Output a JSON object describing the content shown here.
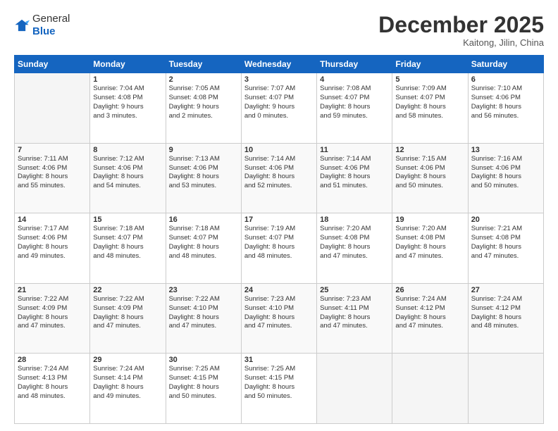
{
  "header": {
    "logo_line1": "General",
    "logo_line2": "Blue",
    "month": "December 2025",
    "location": "Kaitong, Jilin, China"
  },
  "weekdays": [
    "Sunday",
    "Monday",
    "Tuesday",
    "Wednesday",
    "Thursday",
    "Friday",
    "Saturday"
  ],
  "weeks": [
    [
      {
        "day": "",
        "info": ""
      },
      {
        "day": "1",
        "info": "Sunrise: 7:04 AM\nSunset: 4:08 PM\nDaylight: 9 hours\nand 3 minutes."
      },
      {
        "day": "2",
        "info": "Sunrise: 7:05 AM\nSunset: 4:08 PM\nDaylight: 9 hours\nand 2 minutes."
      },
      {
        "day": "3",
        "info": "Sunrise: 7:07 AM\nSunset: 4:07 PM\nDaylight: 9 hours\nand 0 minutes."
      },
      {
        "day": "4",
        "info": "Sunrise: 7:08 AM\nSunset: 4:07 PM\nDaylight: 8 hours\nand 59 minutes."
      },
      {
        "day": "5",
        "info": "Sunrise: 7:09 AM\nSunset: 4:07 PM\nDaylight: 8 hours\nand 58 minutes."
      },
      {
        "day": "6",
        "info": "Sunrise: 7:10 AM\nSunset: 4:06 PM\nDaylight: 8 hours\nand 56 minutes."
      }
    ],
    [
      {
        "day": "7",
        "info": "Sunrise: 7:11 AM\nSunset: 4:06 PM\nDaylight: 8 hours\nand 55 minutes."
      },
      {
        "day": "8",
        "info": "Sunrise: 7:12 AM\nSunset: 4:06 PM\nDaylight: 8 hours\nand 54 minutes."
      },
      {
        "day": "9",
        "info": "Sunrise: 7:13 AM\nSunset: 4:06 PM\nDaylight: 8 hours\nand 53 minutes."
      },
      {
        "day": "10",
        "info": "Sunrise: 7:14 AM\nSunset: 4:06 PM\nDaylight: 8 hours\nand 52 minutes."
      },
      {
        "day": "11",
        "info": "Sunrise: 7:14 AM\nSunset: 4:06 PM\nDaylight: 8 hours\nand 51 minutes."
      },
      {
        "day": "12",
        "info": "Sunrise: 7:15 AM\nSunset: 4:06 PM\nDaylight: 8 hours\nand 50 minutes."
      },
      {
        "day": "13",
        "info": "Sunrise: 7:16 AM\nSunset: 4:06 PM\nDaylight: 8 hours\nand 50 minutes."
      }
    ],
    [
      {
        "day": "14",
        "info": "Sunrise: 7:17 AM\nSunset: 4:06 PM\nDaylight: 8 hours\nand 49 minutes."
      },
      {
        "day": "15",
        "info": "Sunrise: 7:18 AM\nSunset: 4:07 PM\nDaylight: 8 hours\nand 48 minutes."
      },
      {
        "day": "16",
        "info": "Sunrise: 7:18 AM\nSunset: 4:07 PM\nDaylight: 8 hours\nand 48 minutes."
      },
      {
        "day": "17",
        "info": "Sunrise: 7:19 AM\nSunset: 4:07 PM\nDaylight: 8 hours\nand 48 minutes."
      },
      {
        "day": "18",
        "info": "Sunrise: 7:20 AM\nSunset: 4:08 PM\nDaylight: 8 hours\nand 47 minutes."
      },
      {
        "day": "19",
        "info": "Sunrise: 7:20 AM\nSunset: 4:08 PM\nDaylight: 8 hours\nand 47 minutes."
      },
      {
        "day": "20",
        "info": "Sunrise: 7:21 AM\nSunset: 4:08 PM\nDaylight: 8 hours\nand 47 minutes."
      }
    ],
    [
      {
        "day": "21",
        "info": "Sunrise: 7:22 AM\nSunset: 4:09 PM\nDaylight: 8 hours\nand 47 minutes."
      },
      {
        "day": "22",
        "info": "Sunrise: 7:22 AM\nSunset: 4:09 PM\nDaylight: 8 hours\nand 47 minutes."
      },
      {
        "day": "23",
        "info": "Sunrise: 7:22 AM\nSunset: 4:10 PM\nDaylight: 8 hours\nand 47 minutes."
      },
      {
        "day": "24",
        "info": "Sunrise: 7:23 AM\nSunset: 4:10 PM\nDaylight: 8 hours\nand 47 minutes."
      },
      {
        "day": "25",
        "info": "Sunrise: 7:23 AM\nSunset: 4:11 PM\nDaylight: 8 hours\nand 47 minutes."
      },
      {
        "day": "26",
        "info": "Sunrise: 7:24 AM\nSunset: 4:12 PM\nDaylight: 8 hours\nand 47 minutes."
      },
      {
        "day": "27",
        "info": "Sunrise: 7:24 AM\nSunset: 4:12 PM\nDaylight: 8 hours\nand 48 minutes."
      }
    ],
    [
      {
        "day": "28",
        "info": "Sunrise: 7:24 AM\nSunset: 4:13 PM\nDaylight: 8 hours\nand 48 minutes."
      },
      {
        "day": "29",
        "info": "Sunrise: 7:24 AM\nSunset: 4:14 PM\nDaylight: 8 hours\nand 49 minutes."
      },
      {
        "day": "30",
        "info": "Sunrise: 7:25 AM\nSunset: 4:15 PM\nDaylight: 8 hours\nand 50 minutes."
      },
      {
        "day": "31",
        "info": "Sunrise: 7:25 AM\nSunset: 4:15 PM\nDaylight: 8 hours\nand 50 minutes."
      },
      {
        "day": "",
        "info": ""
      },
      {
        "day": "",
        "info": ""
      },
      {
        "day": "",
        "info": ""
      }
    ]
  ]
}
